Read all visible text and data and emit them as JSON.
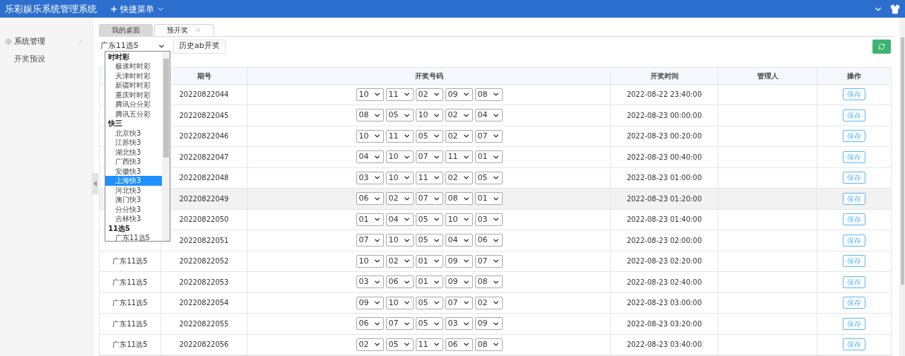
{
  "header": {
    "title": "乐彩娱乐系统管理系统",
    "quick_menu": "快捷菜单"
  },
  "sidebar": {
    "section": {
      "label": "系统管理",
      "expanded": true
    },
    "items": [
      {
        "label": "开奖预设"
      }
    ]
  },
  "tabs": [
    {
      "label": "我的桌面",
      "selected": false,
      "closable": false
    },
    {
      "label": "预开奖",
      "selected": true,
      "closable": true
    }
  ],
  "toolbar": {
    "lottery_select": {
      "value": "广东11选5",
      "open": true
    },
    "history_button": "历史ab开奖"
  },
  "dropdown": {
    "groups": [
      {
        "label": "时时彩",
        "items": [
          {
            "label": "极速时时彩",
            "selected": false
          },
          {
            "label": "天津时时彩",
            "selected": false
          },
          {
            "label": "新疆时时彩",
            "selected": false
          },
          {
            "label": "重庆时时彩",
            "selected": false
          },
          {
            "label": "腾讯分分彩",
            "selected": false
          },
          {
            "label": "腾讯五分彩",
            "selected": false
          }
        ]
      },
      {
        "label": "快三",
        "items": [
          {
            "label": "北京快3",
            "selected": false
          },
          {
            "label": "江苏快3",
            "selected": false
          },
          {
            "label": "湖北快3",
            "selected": false
          },
          {
            "label": "广西快3",
            "selected": false
          },
          {
            "label": "安徽快3",
            "selected": false
          },
          {
            "label": "上海快3",
            "selected": true
          },
          {
            "label": "河北快3",
            "selected": false
          },
          {
            "label": "澳门快3",
            "selected": false
          },
          {
            "label": "分分快3",
            "selected": false
          },
          {
            "label": "吉林快3",
            "selected": false
          }
        ]
      },
      {
        "label": "11选5",
        "items": [
          {
            "label": "广东11选5",
            "selected": false
          }
        ]
      }
    ]
  },
  "table": {
    "columns": [
      "期号",
      "开奖号码",
      "开奖时间",
      "管理人",
      "操作"
    ],
    "rows": [
      {
        "issue": "20220822044",
        "numbers": [
          "10",
          "11",
          "02",
          "09",
          "08"
        ],
        "time": "2022-08-22 23:40:00",
        "action": "保存",
        "highlighted": false
      },
      {
        "issue": "20220822045",
        "numbers": [
          "08",
          "05",
          "10",
          "02",
          "04"
        ],
        "time": "2022-08-23 00:00:00",
        "action": "保存",
        "highlighted": false
      },
      {
        "issue": "20220822046",
        "numbers": [
          "10",
          "11",
          "05",
          "02",
          "07"
        ],
        "time": "2022-08-23 00:20:00",
        "action": "保存",
        "highlighted": false
      },
      {
        "issue": "20220822047",
        "numbers": [
          "04",
          "10",
          "07",
          "11",
          "01"
        ],
        "time": "2022-08-23 00:40:00",
        "action": "保存",
        "highlighted": false
      },
      {
        "issue": "20220822048",
        "numbers": [
          "03",
          "10",
          "11",
          "02",
          "05"
        ],
        "time": "2022-08-23 01:00:00",
        "action": "保存",
        "highlighted": false
      },
      {
        "issue": "20220822049",
        "numbers": [
          "06",
          "02",
          "07",
          "08",
          "01"
        ],
        "time": "2022-08-23 01:20:00",
        "action": "保存",
        "highlighted": true
      },
      {
        "issue": "20220822050",
        "numbers": [
          "01",
          "04",
          "05",
          "10",
          "03"
        ],
        "time": "2022-08-23 01:40:00",
        "action": "保存",
        "highlighted": false
      },
      {
        "issue": "20220822051",
        "numbers": [
          "07",
          "10",
          "05",
          "04",
          "06"
        ],
        "time": "2022-08-23 02:00:00",
        "action": "保存",
        "highlighted": false
      },
      {
        "lottery": "广东11选5",
        "issue": "20220822052",
        "numbers": [
          "10",
          "02",
          "01",
          "09",
          "07"
        ],
        "time": "2022-08-23 02:20:00",
        "action": "保存",
        "highlighted": false
      },
      {
        "lottery": "广东11选5",
        "issue": "20220822053",
        "numbers": [
          "03",
          "06",
          "01",
          "09",
          "08"
        ],
        "time": "2022-08-23 02:40:00",
        "action": "保存",
        "highlighted": false
      },
      {
        "lottery": "广东11选5",
        "issue": "20220822054",
        "numbers": [
          "09",
          "10",
          "05",
          "07",
          "02"
        ],
        "time": "2022-08-23 03:00:00",
        "action": "保存",
        "highlighted": false
      },
      {
        "lottery": "广东11选5",
        "issue": "20220822055",
        "numbers": [
          "06",
          "07",
          "05",
          "03",
          "09"
        ],
        "time": "2022-08-23 03:20:00",
        "action": "保存",
        "highlighted": false
      },
      {
        "lottery": "广东11选5",
        "issue": "20220822056",
        "numbers": [
          "02",
          "05",
          "11",
          "06",
          "08"
        ],
        "time": "2022-08-23 03:40:00",
        "action": "保存",
        "highlighted": false
      }
    ]
  }
}
